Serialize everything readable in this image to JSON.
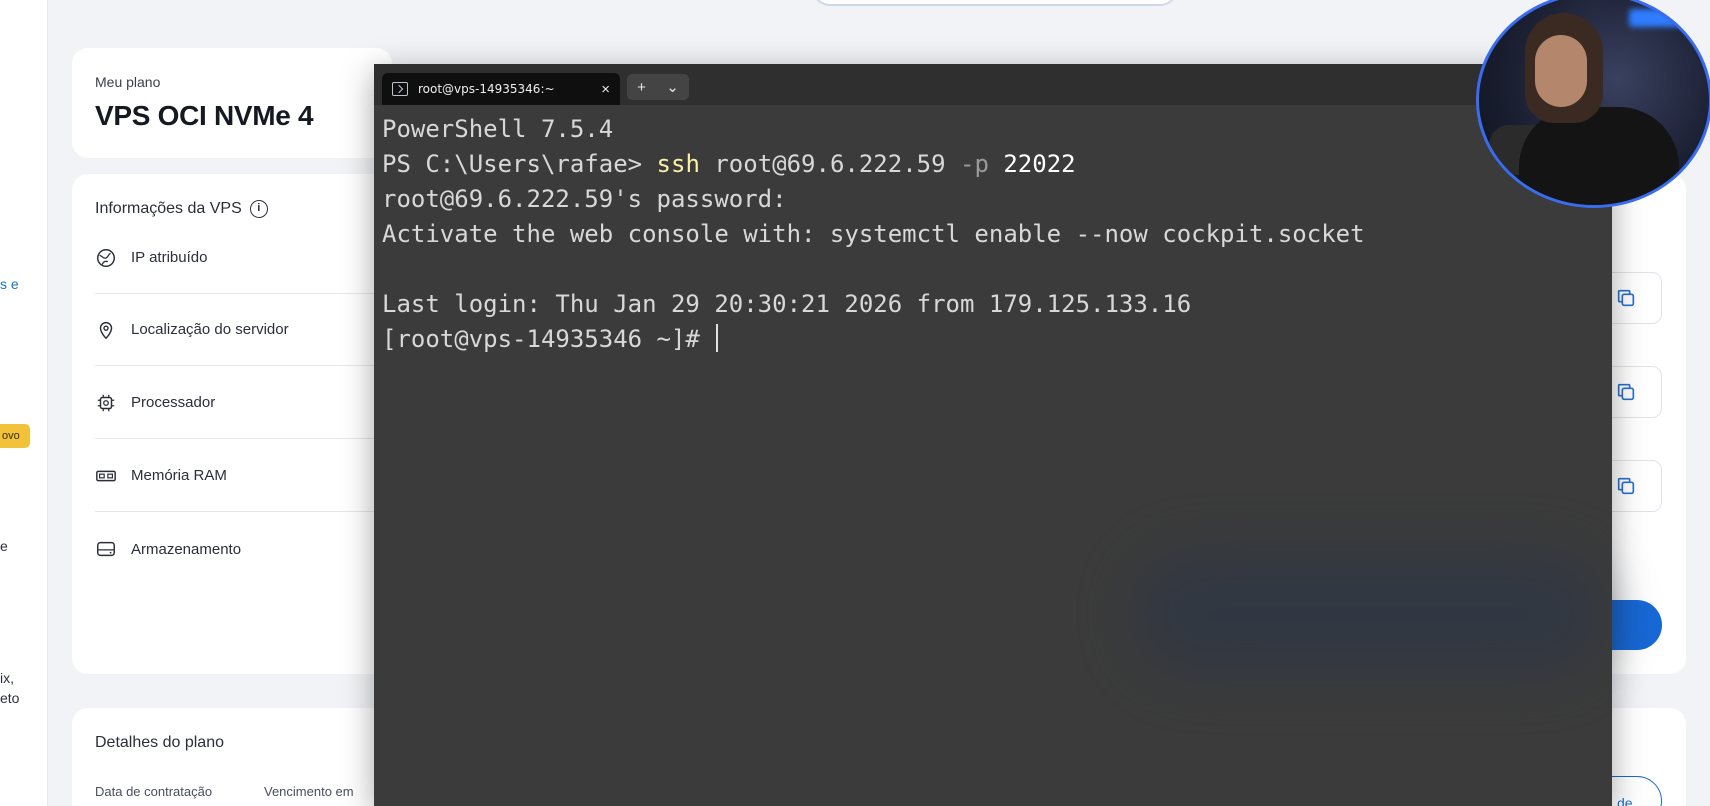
{
  "sidebar": {
    "fragments": [
      {
        "text": "s e",
        "link": true
      },
      {
        "text": "e",
        "link": false
      },
      {
        "text": "ix,",
        "link": false
      },
      {
        "text": "eto",
        "link": false
      }
    ],
    "badge": "ovo"
  },
  "plan": {
    "label": "Meu plano",
    "name": "VPS OCI NVMe 4"
  },
  "vps_info": {
    "title": "Informações da VPS",
    "rows": [
      {
        "label": "IP atribuído",
        "icon": "globe-icon"
      },
      {
        "label": "Localização do servidor",
        "icon": "location-pin-icon"
      },
      {
        "label": "Processador",
        "icon": "cpu-icon"
      },
      {
        "label": "Memória RAM",
        "icon": "memory-icon"
      },
      {
        "label": "Armazenamento",
        "icon": "storage-icon"
      }
    ]
  },
  "plan_details": {
    "title": "Detalhes do plano",
    "columns": [
      "Data de contratação",
      "Vencimento em"
    ]
  },
  "right_panel": {
    "outline_button_label": "de"
  },
  "terminal": {
    "tab_title": "root@vps-14935346:~",
    "tab_close": "×",
    "new_tab": "+",
    "dropdown": "⌄",
    "lines": {
      "l1": "PowerShell 7.5.4",
      "l2_prompt": "PS C:\\Users\\rafae> ",
      "l2_cmd": "ssh",
      "l2_args": " root@69.6.222.59 ",
      "l2_flag": "-p",
      "l2_port": " 22022",
      "l3": "root@69.6.222.59's password:",
      "l4": "Activate the web console with: systemctl enable --now cockpit.socket",
      "l5": "",
      "l6": "Last login: Thu Jan 29 20:30:21 2026 from 179.125.133.16",
      "l7": "[root@vps-14935346 ~]# "
    }
  },
  "colors": {
    "accent": "#1768d6",
    "terminal_bg": "#3b3b3b",
    "command_yellow": "#f9f1a5"
  }
}
